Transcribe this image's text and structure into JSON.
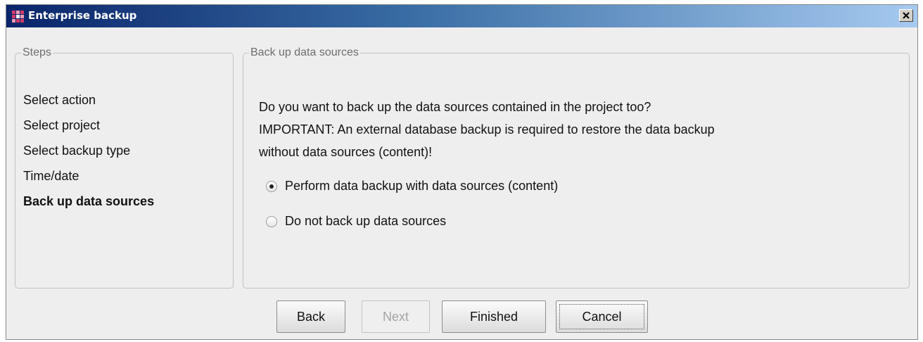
{
  "window": {
    "title": "Enterprise backup",
    "close_label": "close"
  },
  "steps": {
    "legend": "Steps",
    "items": [
      {
        "label": "Select action",
        "active": false
      },
      {
        "label": "Select project",
        "active": false
      },
      {
        "label": "Select backup type",
        "active": false
      },
      {
        "label": "Time/date",
        "active": false
      },
      {
        "label": "Back up data sources",
        "active": true
      }
    ]
  },
  "content": {
    "legend": "Back up data sources",
    "description_lines": [
      "Do you want to back up the data sources contained in the project too?",
      "IMPORTANT: An external database backup is required to restore the data backup",
      "without data sources (content)!"
    ],
    "options": [
      {
        "label": "Perform data backup with data sources (content)",
        "selected": true
      },
      {
        "label": "Do not back up data sources",
        "selected": false
      }
    ]
  },
  "buttons": {
    "back": "Back",
    "next": "Next",
    "finished": "Finished",
    "cancel": "Cancel"
  },
  "colors": {
    "title_bar_start": "#0a246a",
    "title_bar_end": "#a6caf0",
    "dialog_background": "#eeeeee",
    "disabled_text": "#a3a3a3"
  },
  "icons": {
    "app": "enterprise-app-icon",
    "close": "close-x-icon"
  }
}
